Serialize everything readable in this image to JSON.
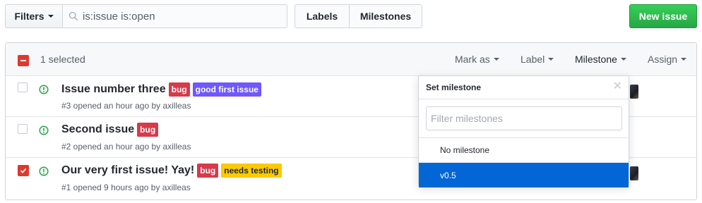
{
  "toolbar": {
    "filters_label": "Filters",
    "search_value": "is:issue is:open",
    "labels_label": "Labels",
    "milestones_label": "Milestones",
    "new_issue_label": "New issue"
  },
  "bulk_header": {
    "selected_text": "1 selected",
    "mark_as": "Mark as",
    "label": "Label",
    "milestone": "Milestone",
    "assign": "Assign"
  },
  "issues": [
    {
      "title": "Issue number three",
      "labels": [
        "bug",
        "good first issue"
      ],
      "meta": "#3 opened an hour ago by axilleas",
      "checked": false
    },
    {
      "title": "Second issue",
      "labels": [
        "bug"
      ],
      "meta": "#2 opened an hour ago by axilleas",
      "checked": false
    },
    {
      "title": "Our very first issue! Yay!",
      "labels": [
        "bug",
        "needs testing"
      ],
      "meta": "#1 opened 9 hours ago by axilleas",
      "checked": true
    }
  ],
  "milestone_menu": {
    "title": "Set milestone",
    "filter_placeholder": "Filter milestones",
    "items": [
      "No milestone",
      "v0.5"
    ],
    "active_item": "v0.5"
  },
  "colors": {
    "primary_green": "#28a745",
    "selected_blue": "#0366d6",
    "bug": "#d73a4a",
    "good_first_issue": "#7057ff",
    "needs_testing": "#fbca04",
    "open_issue_icon": "#28a745",
    "checkbox_red": "#e0382e"
  },
  "icons": {
    "search": "search-icon",
    "issue_open": "issue-opened-icon",
    "close": "close-icon"
  }
}
